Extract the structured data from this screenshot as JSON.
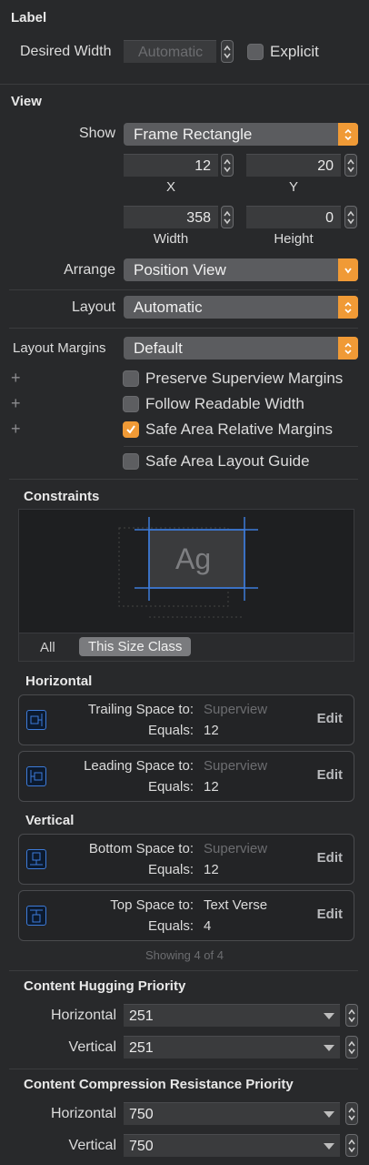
{
  "label_section": {
    "title": "Label",
    "desired_width_label": "Desired Width",
    "desired_width_placeholder": "Automatic",
    "explicit_label": "Explicit"
  },
  "view_section": {
    "title": "View",
    "show_label": "Show",
    "show_value": "Frame Rectangle",
    "x_value": "12",
    "y_value": "20",
    "x_label": "X",
    "y_label": "Y",
    "width_value": "358",
    "height_value": "0",
    "width_label": "Width",
    "height_label": "Height",
    "arrange_label": "Arrange",
    "arrange_value": "Position View",
    "layout_label": "Layout",
    "layout_value": "Automatic",
    "margins_label": "Layout Margins",
    "margins_value": "Default",
    "plus": "+",
    "preserve_label": "Preserve Superview Margins",
    "readable_label": "Follow Readable Width",
    "safe_margins_label": "Safe Area Relative Margins",
    "safe_guide_label": "Safe Area Layout Guide"
  },
  "constraints": {
    "title": "Constraints",
    "preview_text": "Ag",
    "tab_all": "All",
    "tab_size_class": "This Size Class",
    "horizontal_title": "Horizontal",
    "vertical_title": "Vertical",
    "items": [
      {
        "key1": "Trailing Space to:",
        "val1": "Superview",
        "key2": "Equals:",
        "val2": "12",
        "edit": "Edit"
      },
      {
        "key1": "Leading Space to:",
        "val1": "Superview",
        "key2": "Equals:",
        "val2": "12",
        "edit": "Edit"
      },
      {
        "key1": "Bottom Space to:",
        "val1": "Superview",
        "key2": "Equals:",
        "val2": "12",
        "edit": "Edit"
      },
      {
        "key1": "Top Space to:",
        "val1": "Text Verse",
        "key2": "Equals:",
        "val2": "4",
        "edit": "Edit"
      }
    ],
    "showing": "Showing 4 of 4"
  },
  "hugging": {
    "title": "Content Hugging Priority",
    "horizontal_label": "Horizontal",
    "horizontal_value": "251",
    "vertical_label": "Vertical",
    "vertical_value": "251"
  },
  "compression": {
    "title": "Content Compression Resistance Priority",
    "horizontal_label": "Horizontal",
    "horizontal_value": "750",
    "vertical_label": "Vertical",
    "vertical_value": "750"
  },
  "colors": {
    "background": "#28292b",
    "accent": "#f09a36",
    "constraint_blue": "#3d7bd9"
  }
}
